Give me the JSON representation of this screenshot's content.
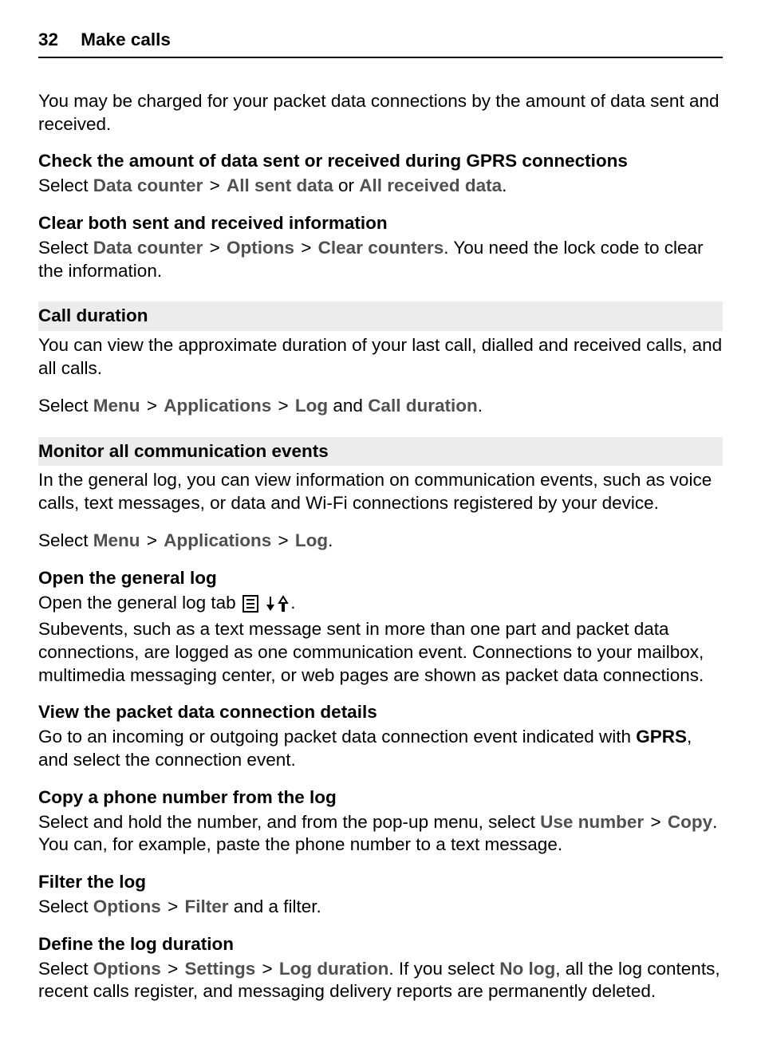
{
  "header": {
    "page_number": "32",
    "chapter_title": "Make calls"
  },
  "intro": "You may be charged for your packet data connections by the amount of data sent and received.",
  "gprs": {
    "heading": "Check the amount of data sent or received during GPRS connections",
    "prefix": "Select ",
    "menu1": "Data counter",
    "menu2": "All sent data",
    "or": " or ",
    "menu3": "All received data",
    "period": "."
  },
  "clear": {
    "heading": "Clear both sent and received information",
    "prefix": "Select ",
    "menu1": "Data counter",
    "menu2": "Options",
    "menu3": "Clear counters",
    "suffix": ". You need the lock code to clear the information."
  },
  "call_duration": {
    "bar": "Call duration",
    "intro": "You can view the approximate duration of your last call, dialled and received calls, and all calls.",
    "select_prefix": "Select ",
    "menu1": "Menu",
    "menu2": "Applications",
    "menu3": "Log",
    "and": " and ",
    "menu4": "Call duration",
    "period": "."
  },
  "monitor": {
    "bar": "Monitor all communication events",
    "intro": "In the general log, you can view information on communication events, such as voice calls, text messages, or data and Wi-Fi connections registered by your device.",
    "select_prefix": "Select ",
    "menu1": "Menu",
    "menu2": "Applications",
    "menu3": "Log",
    "period": "."
  },
  "open_log": {
    "heading": "Open the general log",
    "text_before": "Open the general log tab ",
    "period": ".",
    "subevents": "Subevents, such as a text message sent in more than one part and packet data connections, are logged as one communication event. Connections to your mailbox, multimedia messaging center, or web pages are shown as packet data connections."
  },
  "view_packet": {
    "heading": "View the packet data connection details",
    "prefix": "Go to an incoming or outgoing packet data connection event indicated with ",
    "gprs": "GPRS",
    "suffix": ", and select the connection event."
  },
  "copy": {
    "heading": "Copy a phone number from the log",
    "prefix": "Select and hold the number, and from the pop-up menu, select ",
    "menu1": "Use number",
    "menu2": "Copy",
    "suffix": ". You can, for example, paste the phone number to a text message."
  },
  "filter": {
    "heading": "Filter the log",
    "prefix": "Select ",
    "menu1": "Options",
    "menu2": "Filter",
    "suffix": " and a filter."
  },
  "define": {
    "heading": "Define the log duration",
    "prefix": "Select ",
    "menu1": "Options",
    "menu2": "Settings",
    "menu3": "Log duration",
    "mid": ". If you select ",
    "menu4": "No log",
    "suffix": ", all the log contents, recent calls register, and messaging delivery reports are permanently deleted."
  },
  "gt": ">"
}
